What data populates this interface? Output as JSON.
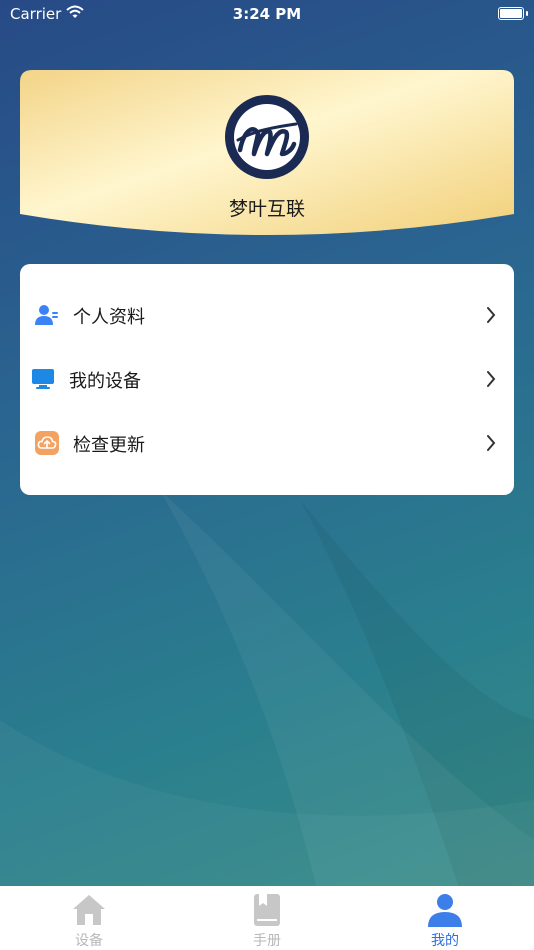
{
  "status_bar": {
    "carrier": "Carrier",
    "time": "3:24 PM"
  },
  "profile": {
    "name": "梦叶互联",
    "logo_icon": "script-m-logo"
  },
  "menu": {
    "items": [
      {
        "label": "个人资料",
        "icon": "user-profile-icon",
        "icon_color": "#3b82f6"
      },
      {
        "label": "我的设备",
        "icon": "monitor-icon",
        "icon_color": "#1e88e5"
      },
      {
        "label": "检查更新",
        "icon": "cloud-upload-icon",
        "icon_color": "#f4a261"
      }
    ]
  },
  "tab_bar": {
    "tabs": [
      {
        "label": "设备",
        "icon": "home-icon",
        "active": false
      },
      {
        "label": "手册",
        "icon": "book-icon",
        "active": false
      },
      {
        "label": "我的",
        "icon": "person-icon",
        "active": true
      }
    ],
    "active_color": "#2f6fe6",
    "inactive_color": "#b8b8b8"
  }
}
